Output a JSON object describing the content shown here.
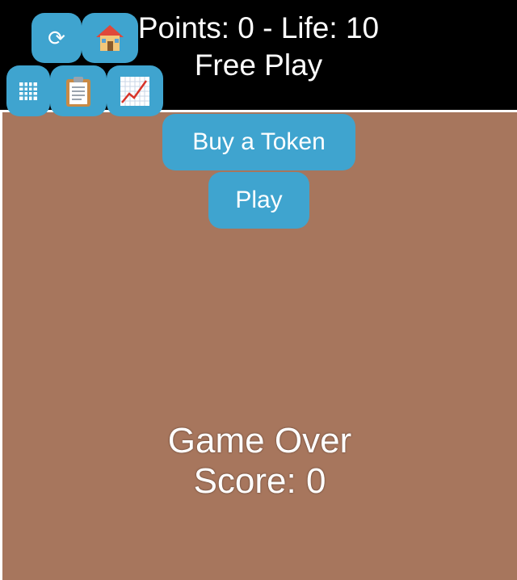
{
  "hud": {
    "points_line": "Points: 0 - Life: 10",
    "mode_line": "Free Play"
  },
  "toolbar": {
    "refresh_icon": "refresh-icon",
    "refresh_glyph": "⟳",
    "home_icon": "house-icon",
    "grid_icon": "grid-icon",
    "clipboard_icon": "clipboard-icon",
    "chart_icon": "chart-increasing-icon"
  },
  "menu": {
    "buy_token_label": "Buy a Token",
    "play_label": "Play"
  },
  "game_over": {
    "title": "Game Over",
    "score_line": "Score: 0"
  },
  "colors": {
    "background_top": "#000000",
    "stage": "#a7765d",
    "button": "#3fa4cf",
    "text": "#ffffff"
  }
}
